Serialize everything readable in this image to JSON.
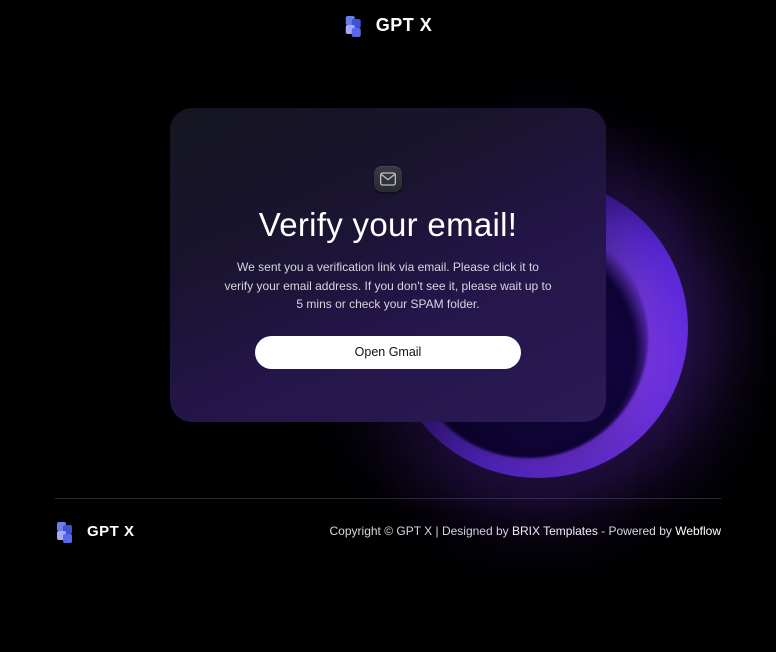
{
  "brand": {
    "name": "GPT X"
  },
  "card": {
    "title": "Verify your email!",
    "description": "We sent you a verification link via email. Please click it to verify your email address. If you don't see it, please wait up to 5 mins or check your SPAM folder.",
    "cta_label": "Open Gmail"
  },
  "footer": {
    "copyright_prefix": "Copyright © GPT X | Designed by ",
    "designer": "BRIX Templates",
    "powered_prefix": " - Powered by ",
    "platform": "Webflow"
  }
}
